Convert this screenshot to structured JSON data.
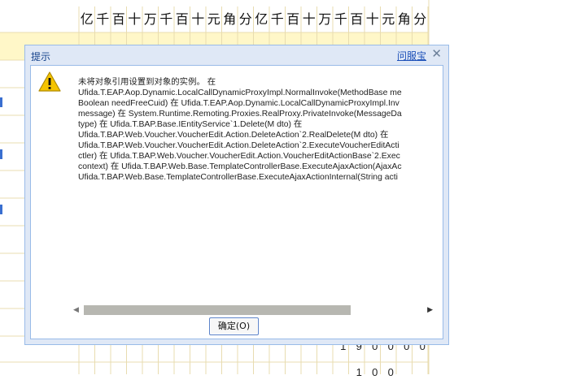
{
  "voucher_grid": {
    "amount_header_chars": [
      "亿",
      "千",
      "百",
      "十",
      "万",
      "千",
      "百",
      "十",
      "元",
      "角",
      "分",
      "亿",
      "千",
      "百",
      "十",
      "万",
      "千",
      "百",
      "十",
      "元",
      "角",
      "分"
    ],
    "row_values": [
      {
        "digits": [
          "1",
          "9",
          "0",
          "0",
          "0",
          "0"
        ]
      },
      {
        "digits": [
          "",
          "1",
          "0",
          "0",
          "",
          ""
        ]
      }
    ]
  },
  "dialog": {
    "title": "提示",
    "help_link": "问服宝",
    "close_symbol": "✕",
    "message_lines": [
      "未将对象引用设置到对象的实例。 在",
      "Ufida.T.EAP.Aop.Dynamic.LocalCallDynamicProxyImpl.NormalInvoke(MethodBase me",
      "Boolean needFreeCuid) 在 Ufida.T.EAP.Aop.Dynamic.LocalCallDynamicProxyImpl.Inv",
      "message) 在 System.Runtime.Remoting.Proxies.RealProxy.PrivateInvoke(MessageDa",
      "type) 在 Ufida.T.BAP.Base.IEntityService`1.Delete(M dto) 在",
      "Ufida.T.BAP.Web.Voucher.VoucherEdit.Action.DeleteAction`2.RealDelete(M dto) 在",
      "Ufida.T.BAP.Web.Voucher.VoucherEdit.Action.DeleteAction`2.ExecuteVoucherEditActi",
      "ctler) 在 Ufida.T.BAP.Web.Voucher.VoucherEdit.Action.VoucherEditActionBase`2.Exec",
      "context) 在 Ufida.T.BAP.Web.Base.TemplateControllerBase.ExecuteAjaxAction(AjaxAc",
      "Ufida.T.BAP.Web.Base.TemplateControllerBase.ExecuteAjaxActionInternal(String acti"
    ],
    "ok_button": "确定(O)",
    "scroll_left": "◀",
    "scroll_right": "▶"
  },
  "colors": {
    "dialog_frame": "#dfe8f6",
    "dialog_border": "#99bbe8",
    "title_text": "#15428b",
    "help_link": "#1b4fb8",
    "grid_line": "#e8dcb0",
    "highlight_row": "#fff7c8",
    "warning_icon": "#f5c400"
  },
  "icons": {
    "warning": "warning-icon",
    "close": "close-icon"
  }
}
